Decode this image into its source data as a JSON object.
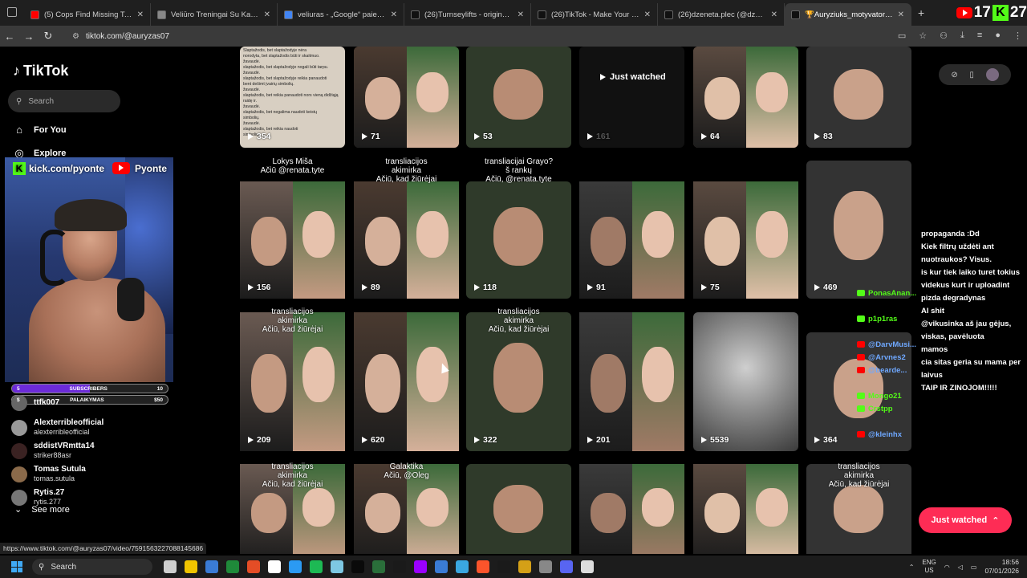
{
  "browser": {
    "tabs": [
      {
        "title": "(5) Cops Find Missing Teen's Bo",
        "color": "#ff0000"
      },
      {
        "title": "Veliūro Treningai Su Kapišonu -",
        "color": "#888888"
      },
      {
        "title": "veliuras - „Google“ paieška",
        "color": "#4285f4"
      },
      {
        "title": "(26)Turnseylifts - original sound",
        "color": "#111111"
      },
      {
        "title": "(26)TikTok - Make Your Day",
        "color": "#111111"
      },
      {
        "title": "(26)dzeneta.plec (@dzeneta.ple",
        "color": "#111111"
      },
      {
        "title": "🏆Auryziuks_motyvatoriuks🏆",
        "color": "#111111"
      }
    ],
    "new_tab": "+",
    "url": "tiktok.com/@auryzas07",
    "counter_yt": "17",
    "counter_kick": "27"
  },
  "sidebar": {
    "logo": "TikTok",
    "search_placeholder": "Search",
    "nav": [
      {
        "label": "For You"
      },
      {
        "label": "Explore"
      }
    ],
    "following": [
      {
        "name": "ttfk007",
        "handle": "",
        "color": "#666"
      },
      {
        "name": "Alexterribleofficial",
        "handle": "alexterribleofficial",
        "color": "#999"
      },
      {
        "name": "sddistVRmtta14",
        "handle": "striker88asr",
        "color": "#3a2222"
      },
      {
        "name": "Tomas Sutula",
        "handle": "tomas.sutula",
        "color": "#8a6a4a"
      },
      {
        "name": "Rytis.27",
        "handle": "rytis.277",
        "color": "#777"
      }
    ],
    "see_more": "See more"
  },
  "stream": {
    "kick_handle": "kick.com/pyonte",
    "yt_handle": "Pyonte",
    "subs_label": "SUBSCRIBERS",
    "subs_left": "5",
    "subs_right": "10",
    "subs_progress": 0.5,
    "support_label": "PALAIKYMAS",
    "support_left": "$",
    "support_right": "$50",
    "support_progress": 0
  },
  "grid": {
    "just_watched": "Just watched",
    "cards": [
      {
        "views": "354",
        "cap": ""
      },
      {
        "views": "71",
        "cap": ""
      },
      {
        "views": "53",
        "cap": ""
      },
      {
        "views": "161",
        "cap": ""
      },
      {
        "views": "64",
        "cap": ""
      },
      {
        "views": "83",
        "cap": ""
      },
      {
        "views": "156",
        "cap": "Lokys Miša\nAčiū @renata.tyte"
      },
      {
        "views": "89",
        "cap": "transliacijos\nakimirka\nAčiū, kad žiūrėjai"
      },
      {
        "views": "118",
        "cap": "transliacijai Grayo?\nš rankų\nAčiū, @renata.tyte"
      },
      {
        "views": "91",
        "cap": ""
      },
      {
        "views": "75",
        "cap": ""
      },
      {
        "views": "469",
        "cap": ""
      },
      {
        "views": "209",
        "cap": "transliacijos\nakimirka\nAčiū, kad žiūrėjai"
      },
      {
        "views": "620",
        "cap": ""
      },
      {
        "views": "322",
        "cap": "transliacijos\nakimirka\nAčiū, kad žiūrėjai"
      },
      {
        "views": "201",
        "cap": ""
      },
      {
        "views": "5539",
        "cap": ""
      },
      {
        "views": "364",
        "cap": ""
      },
      {
        "views": "",
        "cap": "transliacijos\nakimirka\nAčiū, kad žiūrėjai"
      },
      {
        "views": "",
        "cap": "Galaktika\nAčiū, @Oleg"
      },
      {
        "views": "",
        "cap": ""
      },
      {
        "views": "",
        "cap": ""
      },
      {
        "views": "",
        "cap": ""
      },
      {
        "views": "",
        "cap": "transliacijos\nakimirka\nAčiū, kad žiūrėjai"
      }
    ]
  },
  "password_text": "Slaptažodis, bet slaptažodyje nėra\nnorodyta, bet slaptažodis būti ir skaitmuo.\nžavaudė.\nslaptažodis, bet slaptažodyje nogali būti tarpu.\nžavaudė.\nslaptažodis, bet slaptažodyje reikia panaudoti\nbent dešimt įvairių simbolių.\nžavaudė.\nslaptažodis, bet reikia panaudoti nors vieną didžiąją\nraidę ir.\nžavaudė.\nslaptažodis, bet negalima naudoti keistų\nsimbolių.\nžavaudė.\nslaptažodis, bet reikia naudoti\nsimbolius.",
  "right": {
    "just_watched_btn": "Just watched"
  },
  "chat": [
    {
      "user": "",
      "text": "propaganda :Dd",
      "type": "none"
    },
    {
      "user": "",
      "text": "Kiek filtrų uždėti ant",
      "type": "none"
    },
    {
      "user": "",
      "text": "nuotraukos? Visus.",
      "type": "none"
    },
    {
      "user": "",
      "text": "is kur tiek laiko turet tokius",
      "type": "none"
    },
    {
      "user": "",
      "text": "videkus kurt ir uploadint",
      "type": "none"
    },
    {
      "user": "",
      "text": "pizda degradynas",
      "type": "none"
    },
    {
      "user": "",
      "text": "AI shit",
      "type": "none"
    },
    {
      "user": "",
      "text": "@vikusinka aš jau gėjus,",
      "type": "none"
    },
    {
      "user": "",
      "text": "viskas, pavėluota",
      "type": "none"
    },
    {
      "user": "",
      "text": "mamos",
      "type": "none"
    },
    {
      "user": "",
      "text": "cia sitas geria su mama per",
      "type": "none"
    },
    {
      "user": "",
      "text": "laivus",
      "type": "none"
    },
    {
      "user": "",
      "text": "TAIP IR ZINOJOM!!!!!",
      "type": "none"
    }
  ],
  "chat_users": [
    {
      "name": "PonasAnan...",
      "type": "kick"
    },
    {
      "name": "p1p1ras",
      "type": "kick"
    },
    {
      "name": "@DarvMusi...",
      "type": "yt"
    },
    {
      "name": "@Arvnes2",
      "type": "yt"
    },
    {
      "name": "@bearde...",
      "type": "yt"
    },
    {
      "name": "Mongo21",
      "type": "kick"
    },
    {
      "name": "Crstpp",
      "type": "kick"
    },
    {
      "name": "@kleinhx",
      "type": "yt"
    }
  ],
  "status_url": "https://www.tiktok.com/@auryzas07/video/7591563227088145686",
  "taskbar": {
    "search": "Search",
    "lang_top": "ENG",
    "lang_bottom": "US",
    "time": "18:56",
    "date": "07/01/2026"
  }
}
